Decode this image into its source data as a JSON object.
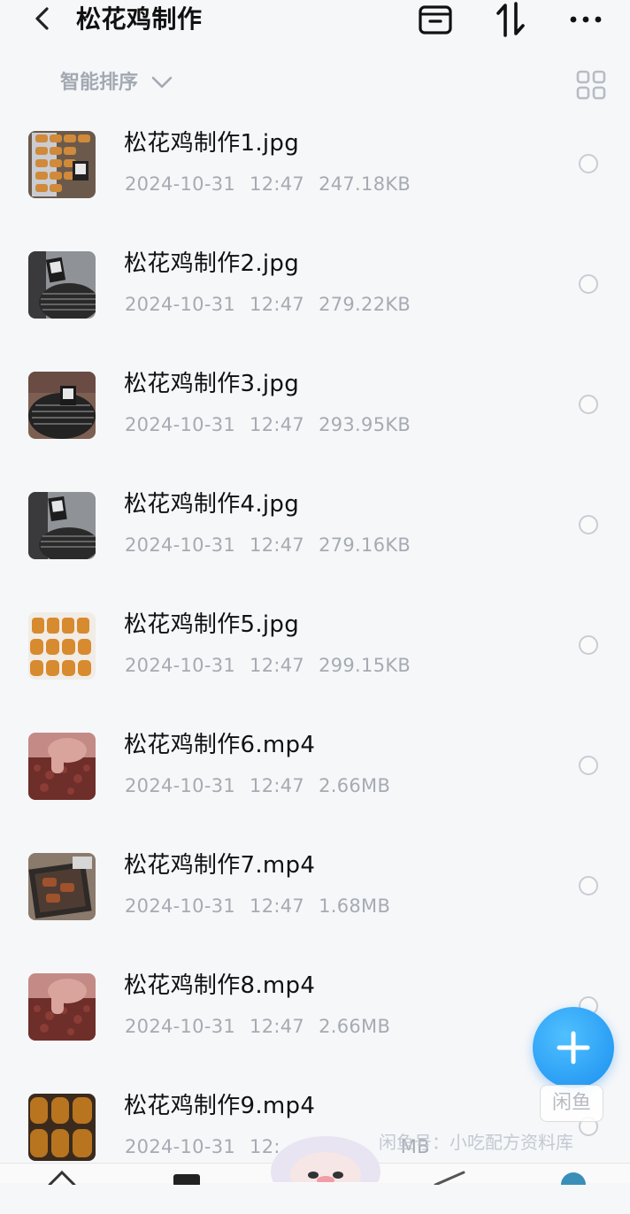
{
  "header": {
    "title": "松花鸡制作",
    "icons": [
      "back-icon",
      "archive-icon",
      "sort-arrows-icon",
      "more-icon"
    ]
  },
  "sort": {
    "label": "智能排序",
    "icon": "chevron-down-icon",
    "view_icon": "grid-view-icon"
  },
  "files": [
    {
      "name": "松花鸡制作1.jpg",
      "date": "2024-10-31",
      "time": "12:47",
      "size": "247.18KB",
      "thumb": "image"
    },
    {
      "name": "松花鸡制作2.jpg",
      "date": "2024-10-31",
      "time": "12:47",
      "size": "279.22KB",
      "thumb": "image"
    },
    {
      "name": "松花鸡制作3.jpg",
      "date": "2024-10-31",
      "time": "12:47",
      "size": "293.95KB",
      "thumb": "image"
    },
    {
      "name": "松花鸡制作4.jpg",
      "date": "2024-10-31",
      "time": "12:47",
      "size": "279.16KB",
      "thumb": "image"
    },
    {
      "name": "松花鸡制作5.jpg",
      "date": "2024-10-31",
      "time": "12:47",
      "size": "299.15KB",
      "thumb": "image"
    },
    {
      "name": "松花鸡制作6.mp4",
      "date": "2024-10-31",
      "time": "12:47",
      "size": "2.66MB",
      "thumb": "video"
    },
    {
      "name": "松花鸡制作7.mp4",
      "date": "2024-10-31",
      "time": "12:47",
      "size": "1.68MB",
      "thumb": "video"
    },
    {
      "name": "松花鸡制作8.mp4",
      "date": "2024-10-31",
      "time": "12:47",
      "size": "2.66MB",
      "thumb": "video"
    },
    {
      "name": "松花鸡制作9.mp4",
      "date": "2024-10-31",
      "time": "12:",
      "size": "MB",
      "thumb": "video"
    }
  ],
  "fab": {
    "icon": "plus-icon",
    "color": "#1b8ff0"
  },
  "watermark": {
    "badge": "闲鱼",
    "text": "闲鱼号：小吃配方资料库"
  },
  "colors": {
    "background": "#f6f7f9",
    "meta_text": "#a6abb2",
    "accent": "#1b8ff0"
  }
}
